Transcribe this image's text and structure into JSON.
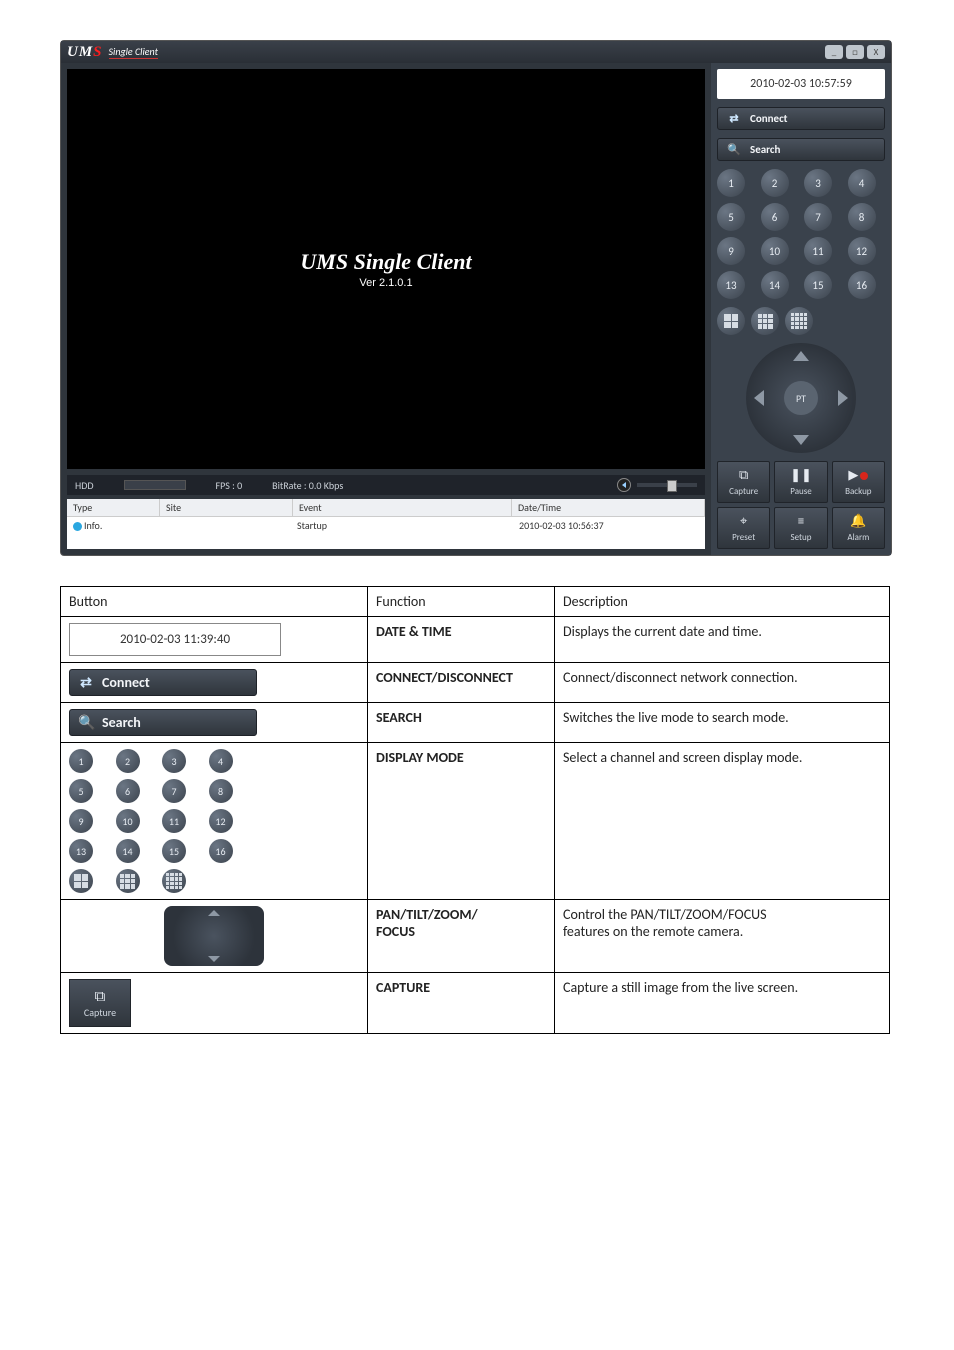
{
  "app": {
    "logo_prefix": "UM",
    "logo_suffix": "S",
    "subtitle": "Single Client",
    "video_title": "UMS Single Client",
    "video_version": "Ver 2.1.0.1",
    "status": {
      "hdd": "HDD",
      "fps": "FPS : 0",
      "bitrate": "BitRate : 0.0 Kbps"
    },
    "log": {
      "headers": {
        "type": "Type",
        "site": "Site",
        "event": "Event",
        "datetime": "Date/Time"
      },
      "rows": [
        {
          "type": "Info.",
          "site": "",
          "event": "Startup",
          "datetime": "2010-02-03 10:56:37"
        }
      ]
    }
  },
  "side": {
    "clock": "2010-02-03 10:57:59",
    "connect": "Connect",
    "search": "Search",
    "pt": "PT",
    "channels": [
      "1",
      "2",
      "3",
      "4",
      "5",
      "6",
      "7",
      "8",
      "9",
      "10",
      "11",
      "12",
      "13",
      "14",
      "15",
      "16"
    ],
    "actions": {
      "capture": "Capture",
      "pause": "Pause",
      "backup": "Backup",
      "preset": "Preset",
      "setup": "Setup",
      "alarm": "Alarm"
    }
  },
  "table": {
    "headers": {
      "button": "Button",
      "function": "Function",
      "description": "Description"
    },
    "rows": {
      "datetime": {
        "thumb_clock": "2010-02-03 11:39:40",
        "func": "DATE & TIME",
        "desc": "Displays the current date and time."
      },
      "connect": {
        "label": "Connect",
        "func": "CONNECT/DISCONNECT",
        "desc": "Connect/disconnect network connection."
      },
      "search": {
        "label": "Search",
        "func": "SEARCH",
        "desc": "Switches the live mode to search mode."
      },
      "display": {
        "func": "DISPLAY MODE",
        "desc": "Select a channel and screen display mode."
      },
      "ptz": {
        "func1": "PAN/TILT/ZOOM/",
        "func2": "FOCUS",
        "desc1": "Control the PAN/TILT/ZOOM/FOCUS",
        "desc2": "features on the remote camera."
      },
      "capture": {
        "label": "Capture",
        "func": "CAPTURE",
        "desc": "Capture a still image from the live screen."
      }
    }
  }
}
